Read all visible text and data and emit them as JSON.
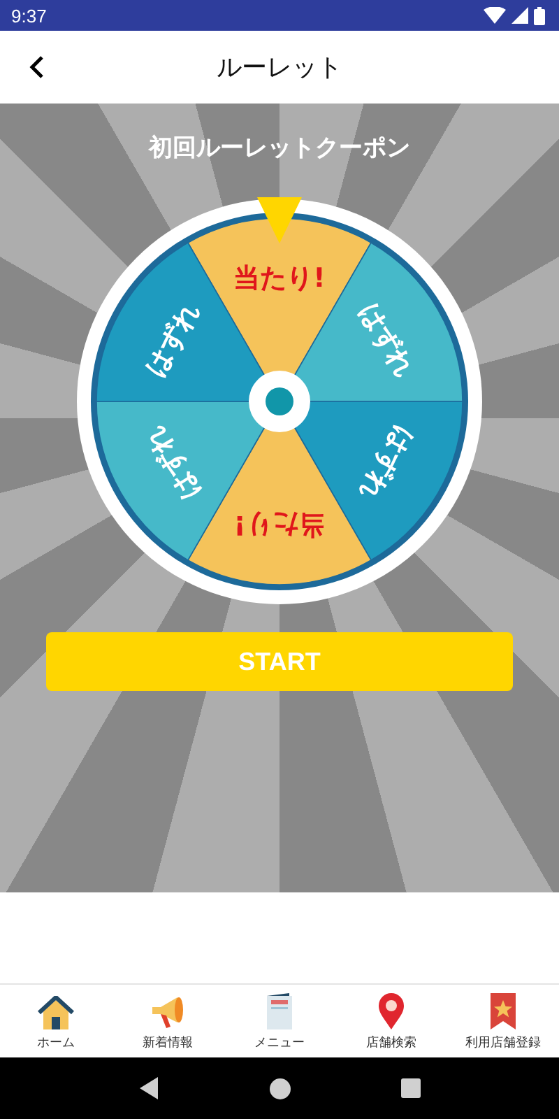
{
  "status_bar": {
    "time": "9:37"
  },
  "header": {
    "title": "ルーレット"
  },
  "roulette": {
    "title": "初回ルーレットクーポン",
    "segments": [
      {
        "label": "当たり!",
        "kind": "win",
        "color": "#f5c35a"
      },
      {
        "label": "はずれ",
        "kind": "lose",
        "color": "#46b9c9"
      },
      {
        "label": "はずれ",
        "kind": "lose",
        "color": "#1e9bbf"
      },
      {
        "label": "当たり!",
        "kind": "win",
        "color": "#f5c35a"
      },
      {
        "label": "はずれ",
        "kind": "lose",
        "color": "#46b9c9"
      },
      {
        "label": "はずれ",
        "kind": "lose",
        "color": "#1e9bbf"
      }
    ],
    "start_button": "START"
  },
  "bottom_nav": [
    {
      "label": "ホーム",
      "kind": "home"
    },
    {
      "label": "新着情報",
      "kind": "news"
    },
    {
      "label": "メニュー",
      "kind": "menu"
    },
    {
      "label": "店舗検索",
      "kind": "search"
    },
    {
      "label": "利用店舗登録",
      "kind": "register"
    }
  ]
}
